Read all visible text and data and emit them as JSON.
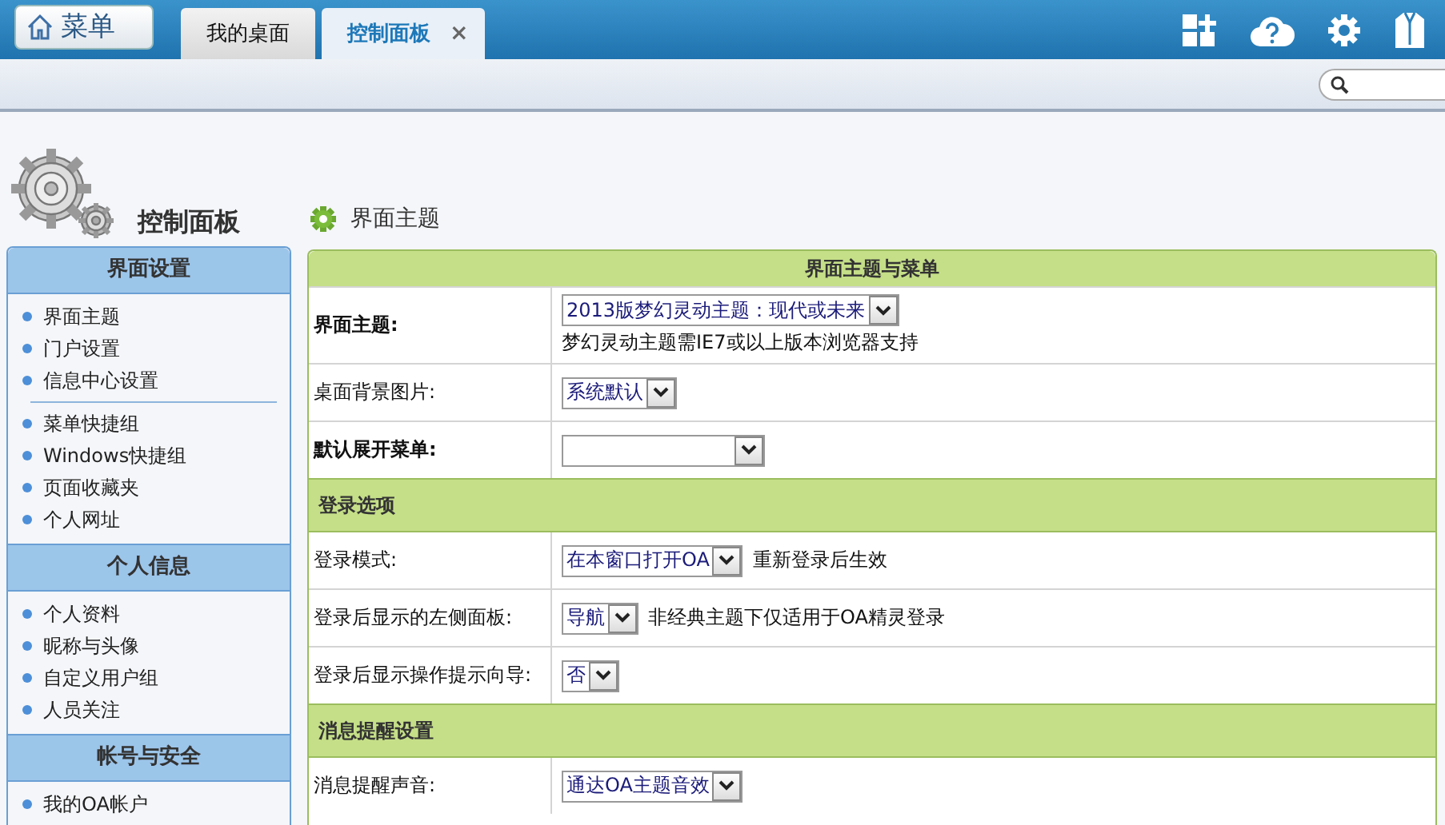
{
  "top_bar": {
    "menu_button": "菜单",
    "tabs": [
      {
        "label": "我的桌面",
        "selected": false
      },
      {
        "label": "控制面板",
        "selected": true,
        "close": "×"
      }
    ]
  },
  "sidebar": {
    "title": "控制面板",
    "groups": [
      {
        "title": "界面设置",
        "sections": [
          [
            "界面主题",
            "门户设置",
            "信息中心设置"
          ],
          [
            "菜单快捷组",
            "Windows快捷组",
            "页面收藏夹",
            "个人网址"
          ]
        ]
      },
      {
        "title": "个人信息",
        "sections": [
          [
            "个人资料",
            "昵称与头像",
            "自定义用户组",
            "人员关注"
          ]
        ]
      },
      {
        "title": "帐号与安全",
        "sections": [
          [
            "我的OA帐户"
          ]
        ]
      }
    ]
  },
  "main": {
    "title": "界面主题",
    "panel_title": "界面主题与菜单",
    "rows": [
      {
        "kind": "field_stacked",
        "label": "界面主题:",
        "bold": true,
        "value": "2013版梦幻灵动主题：现代或未来",
        "note": "梦幻灵动主题需IE7或以上版本浏览器支持"
      },
      {
        "kind": "field",
        "label": "桌面背景图片:",
        "bold": false,
        "value": "系统默认"
      },
      {
        "kind": "field",
        "label": "默认展开菜单:",
        "bold": true
      },
      {
        "kind": "section",
        "label": "登录选项"
      },
      {
        "kind": "field",
        "label": "登录模式:",
        "bold": false,
        "value": "在本窗口打开OA",
        "note": "重新登录后生效"
      },
      {
        "kind": "field",
        "label": "登录后显示的左侧面板:",
        "bold": false,
        "value": "导航",
        "note": "非经典主题下仅适用于OA精灵登录"
      },
      {
        "kind": "field",
        "label": "登录后显示操作提示向导:",
        "bold": false,
        "value": "否"
      },
      {
        "kind": "section",
        "label": "消息提醒设置"
      },
      {
        "kind": "field",
        "label": "消息提醒声音:",
        "bold": false,
        "value": "通达OA主题音效"
      }
    ]
  }
}
